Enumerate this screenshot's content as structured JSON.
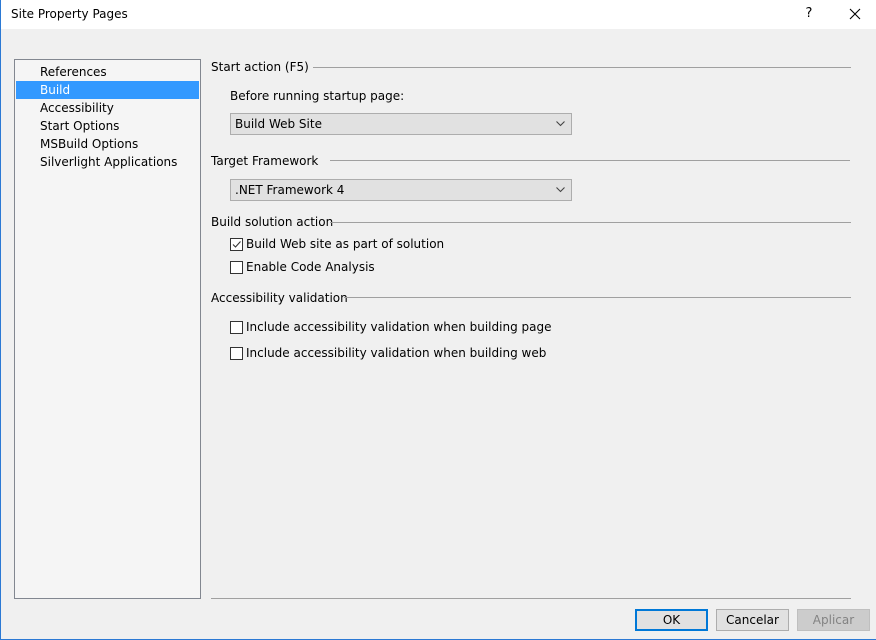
{
  "window": {
    "title": "Site Property Pages",
    "help_label": "?",
    "close_icon": "close-icon"
  },
  "nav": {
    "items": [
      {
        "label": "References",
        "selected": false
      },
      {
        "label": "Build",
        "selected": true
      },
      {
        "label": "Accessibility",
        "selected": false
      },
      {
        "label": "Start Options",
        "selected": false
      },
      {
        "label": "MSBuild Options",
        "selected": false
      },
      {
        "label": "Silverlight Applications",
        "selected": false
      }
    ]
  },
  "build": {
    "start_action": {
      "header": "Start action (F5)",
      "before_label": "Before running startup page:",
      "before_value": "Build Web Site"
    },
    "target_framework": {
      "header": "Target Framework",
      "value": ".NET Framework 4"
    },
    "build_solution": {
      "header": "Build solution action",
      "options": [
        {
          "label": "Build Web site as part of solution",
          "checked": true
        },
        {
          "label": "Enable Code Analysis",
          "checked": false
        }
      ]
    },
    "accessibility": {
      "header": "Accessibility validation",
      "options": [
        {
          "label": "Include accessibility validation when building page",
          "checked": false
        },
        {
          "label": "Include accessibility validation when building web",
          "checked": false
        }
      ]
    }
  },
  "buttons": {
    "ok": "OK",
    "cancel": "Cancelar",
    "apply": "Aplicar"
  },
  "colors": {
    "accent": "#0078d7",
    "selection": "#3399ff",
    "window_border": "#2b79d4"
  }
}
